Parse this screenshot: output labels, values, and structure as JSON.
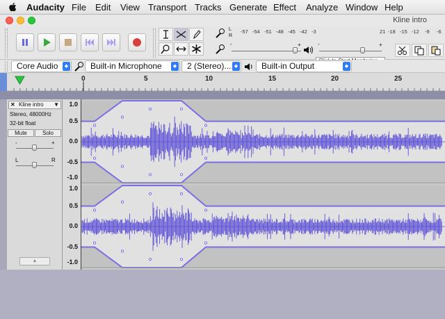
{
  "menubar": {
    "app_name": "Audacity",
    "items": [
      "File",
      "Edit",
      "View",
      "Transport",
      "Tracks",
      "Generate",
      "Effect",
      "Analyze",
      "Window",
      "Help"
    ]
  },
  "window": {
    "title": "Kline intro",
    "traffic_light_colors": [
      "#ff5f57",
      "#febc2e",
      "#28c840"
    ]
  },
  "transport": {
    "buttons": [
      "pause-icon",
      "play-icon",
      "stop-icon",
      "skip-to-start-icon",
      "skip-to-end-icon",
      "record-icon"
    ],
    "accent": "#7a7adf",
    "record_color": "#d94040",
    "play_color": "#3ba93b"
  },
  "tools": [
    "selection-tool",
    "envelope-tool",
    "draw-tool",
    "zoom-tool",
    "timeshift-tool",
    "multi-tool"
  ],
  "meters": {
    "record_ticks": [
      "-57",
      "-54",
      "-51",
      "-48",
      "-45",
      "-42",
      "-3"
    ],
    "record_tip": "Click to Start Monitoring",
    "play_ticks": [
      "21",
      "-18",
      "-15",
      "-12",
      "-9",
      "-6"
    ],
    "lr_l": "L",
    "lr_r": "R",
    "minus": "-",
    "plus": "+"
  },
  "devices": {
    "host": "Core Audio",
    "input": "Built-in Microphone",
    "channels": "2 (Stereo)...",
    "output": "Built-in Output"
  },
  "timeline": {
    "labels": [
      "0",
      "5",
      "10",
      "15",
      "20",
      "25"
    ]
  },
  "track": {
    "name": "Kline intro",
    "format_line1": "Stereo, 48000Hz",
    "format_line2": "32-bit float",
    "mute_label": "Mute",
    "solo_label": "Solo",
    "gain_minus": "-",
    "gain_plus": "+",
    "pan_left": "L",
    "pan_right": "R",
    "collapse_symbol": "▲",
    "scale": [
      "1.0",
      "0.5",
      "0.0",
      "-0.5",
      "-1.0"
    ],
    "waveform_color": "#5b4fd6",
    "envelope_color": "#7a6ee0"
  }
}
